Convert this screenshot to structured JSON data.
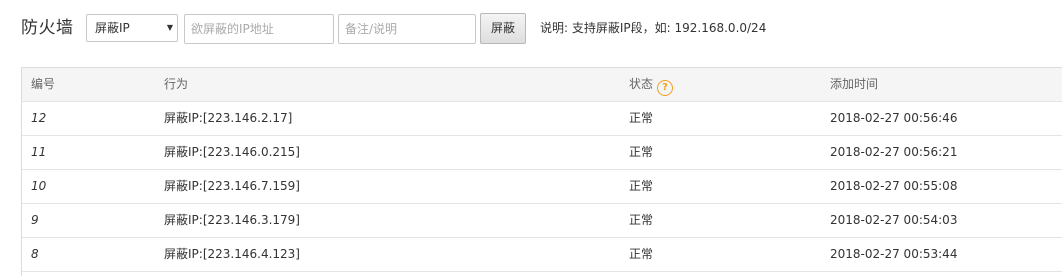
{
  "header": {
    "title": "防火墙",
    "select": {
      "value": "屏蔽IP"
    },
    "ip_input": {
      "placeholder": "欲屏蔽的IP地址",
      "value": ""
    },
    "note_input": {
      "placeholder": "备注/说明",
      "value": ""
    },
    "block_button": "屏蔽",
    "hint": "说明: 支持屏蔽IP段，如: 192.168.0.0/24"
  },
  "table": {
    "columns": [
      "编号",
      "行为",
      "状态",
      "添加时间"
    ],
    "rows": [
      {
        "id": "12",
        "action": "屏蔽IP:[223.146.2.17]",
        "status": "正常",
        "time": "2018-02-27 00:56:46"
      },
      {
        "id": "11",
        "action": "屏蔽IP:[223.146.0.215]",
        "status": "正常",
        "time": "2018-02-27 00:56:21"
      },
      {
        "id": "10",
        "action": "屏蔽IP:[223.146.7.159]",
        "status": "正常",
        "time": "2018-02-27 00:55:08"
      },
      {
        "id": "9",
        "action": "屏蔽IP:[223.146.3.179]",
        "status": "正常",
        "time": "2018-02-27 00:54:03"
      },
      {
        "id": "8",
        "action": "屏蔽IP:[223.146.4.123]",
        "status": "正常",
        "time": "2018-02-27 00:53:44"
      }
    ]
  },
  "icons": {
    "status_help": "question-circle-icon",
    "select_arrow": "caret-down-icon"
  },
  "colors": {
    "help_icon": "#f0a020",
    "header_bg": "#f5f5f5"
  }
}
